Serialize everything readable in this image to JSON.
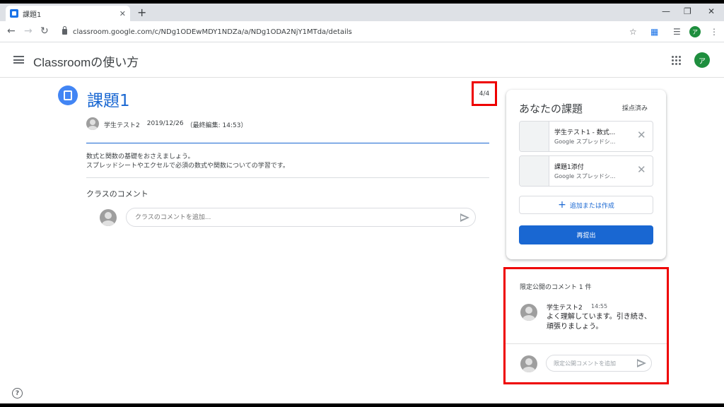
{
  "browser": {
    "tab_title": "課題1",
    "tab_close": "✕",
    "new_tab": "+",
    "url": "classroom.google.com/c/NDg1ODEwMDY1NDZa/a/NDg1ODA2NjY1MTda/details",
    "profile_initial": "ア"
  },
  "app": {
    "class_name": "Classroomの使い方",
    "user_initial": "ア"
  },
  "assignment": {
    "title": "課題1",
    "page_count": "4/4",
    "author": "学生テスト2",
    "date": "2019/12/26",
    "edited": "（最終編集: 14:53）",
    "description": [
      "数式と関数の基礎をおさえましょう。",
      "スプレッドシートやエクセルで必須の数式や関数についての学習です。"
    ],
    "class_comments_label": "クラスのコメント",
    "class_comment_placeholder": "クラスのコメントを追加..."
  },
  "your_work": {
    "title": "あなたの課題",
    "status": "採点済み",
    "attachments": [
      {
        "name": "学生テスト1 - 数式...",
        "type": "Google スプレッドシ..."
      },
      {
        "name": "課題1添付",
        "type": "Google スプレッドシ..."
      }
    ],
    "add_or_create": "追加または作成",
    "resubmit": "再提出"
  },
  "private_comments": {
    "title": "限定公開のコメント 1 件",
    "comments": [
      {
        "author": "学生テスト2",
        "time": "14:55",
        "text": "よく理解しています。引き続き、頑張りましょう。"
      }
    ],
    "placeholder": "限定公開コメントを追加"
  },
  "help": "?"
}
